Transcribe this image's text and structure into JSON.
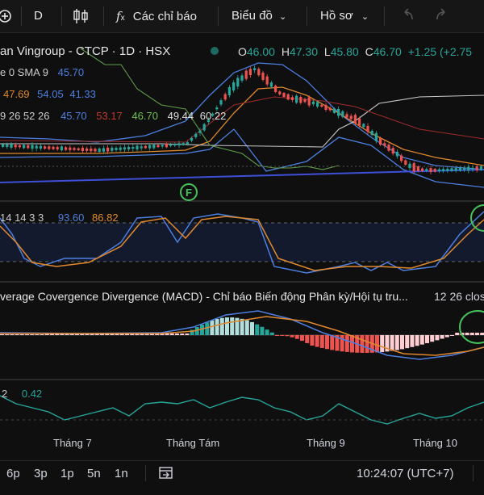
{
  "toolbar": {
    "interval": "D",
    "indicators_label": "Các chỉ báo",
    "chart_label": "Biểu đồ",
    "profile_label": "Hồ sơ"
  },
  "symbol": {
    "title": "an Vingroup - CTCP · 1D · HSX",
    "o_key": "O",
    "o_val": "46.00",
    "h_key": "H",
    "h_val": "47.30",
    "l_key": "L",
    "l_val": "45.80",
    "c_key": "C",
    "c_val": "46.70",
    "change": "+1.25 (+2.75",
    "colors": {
      "up": "#26a69a",
      "down": "#ef5350"
    }
  },
  "legend": {
    "row1": {
      "name": "e 0 SMA 9",
      "v1": "45.70"
    },
    "row2": {
      "v1": "47.69",
      "v2": "54.05",
      "v3": "41.33"
    },
    "row3": {
      "name": "9 26 52 26",
      "v1": "45.70",
      "v2": "53.17",
      "v3": "46.70",
      "v4": "49.44",
      "v5": "60.22"
    }
  },
  "event_marker": "F",
  "stoch": {
    "name": "14 14 3 3",
    "v1": "93.60",
    "v2": "86.82"
  },
  "macd": {
    "title": "verage Covergence Divergence (MACD) - Chỉ báo Biến động Phân kỳ/Hội tụ tru...",
    "params": "12 26 clos"
  },
  "bottom_ind": {
    "name": "2",
    "v1": "0.42"
  },
  "time_axis": [
    "Tháng 7",
    "Tháng Tám",
    "Tháng 9",
    "Tháng 10"
  ],
  "ranges": [
    "6p",
    "3p",
    "1p",
    "5n",
    "1n"
  ],
  "clock": "10:24:07 (UTC+7)"
}
